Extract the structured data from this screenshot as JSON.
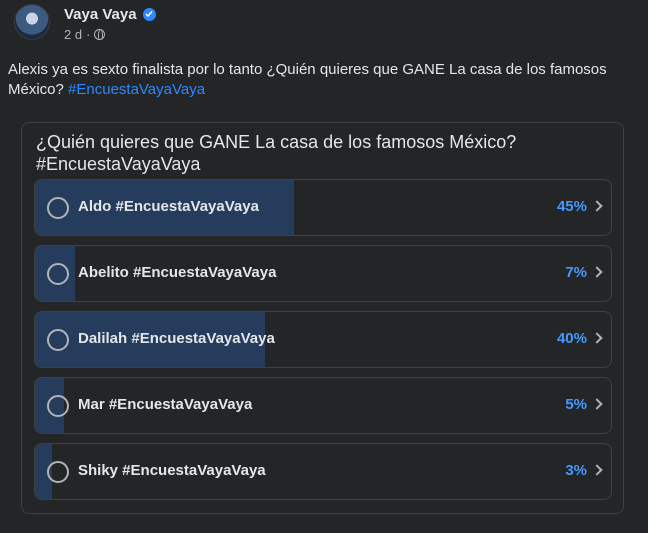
{
  "post": {
    "author": "Vaya Vaya",
    "time": "2 d",
    "separator": "·",
    "text": "Alexis ya es sexto finalista por lo tanto ¿Quién quieres que GANE La casa de los famosos México?",
    "hashtag": "#EncuestaVayaVaya"
  },
  "poll": {
    "question": "¿Quién quieres que GANE La casa de los famosos México? #EncuestaVayaVaya",
    "options": [
      {
        "label": "Aldo #EncuestaVayaVaya",
        "percent": "45%",
        "value": 45
      },
      {
        "label": "Abelito #EncuestaVayaVaya",
        "percent": "7%",
        "value": 7
      },
      {
        "label": "Dalilah #EncuestaVayaVaya",
        "percent": "40%",
        "value": 40
      },
      {
        "label": "Mar #EncuestaVayaVaya",
        "percent": "5%",
        "value": 5
      },
      {
        "label": "Shiky #EncuestaVayaVaya",
        "percent": "3%",
        "value": 3
      }
    ]
  },
  "colors": {
    "background": "#242526",
    "accent": "#2d88ff",
    "fill": "#263c5c",
    "percent": "#4599ff"
  },
  "icons": [
    "verified-badge-icon",
    "globe-icon",
    "radio-icon",
    "chevron-right-icon"
  ]
}
